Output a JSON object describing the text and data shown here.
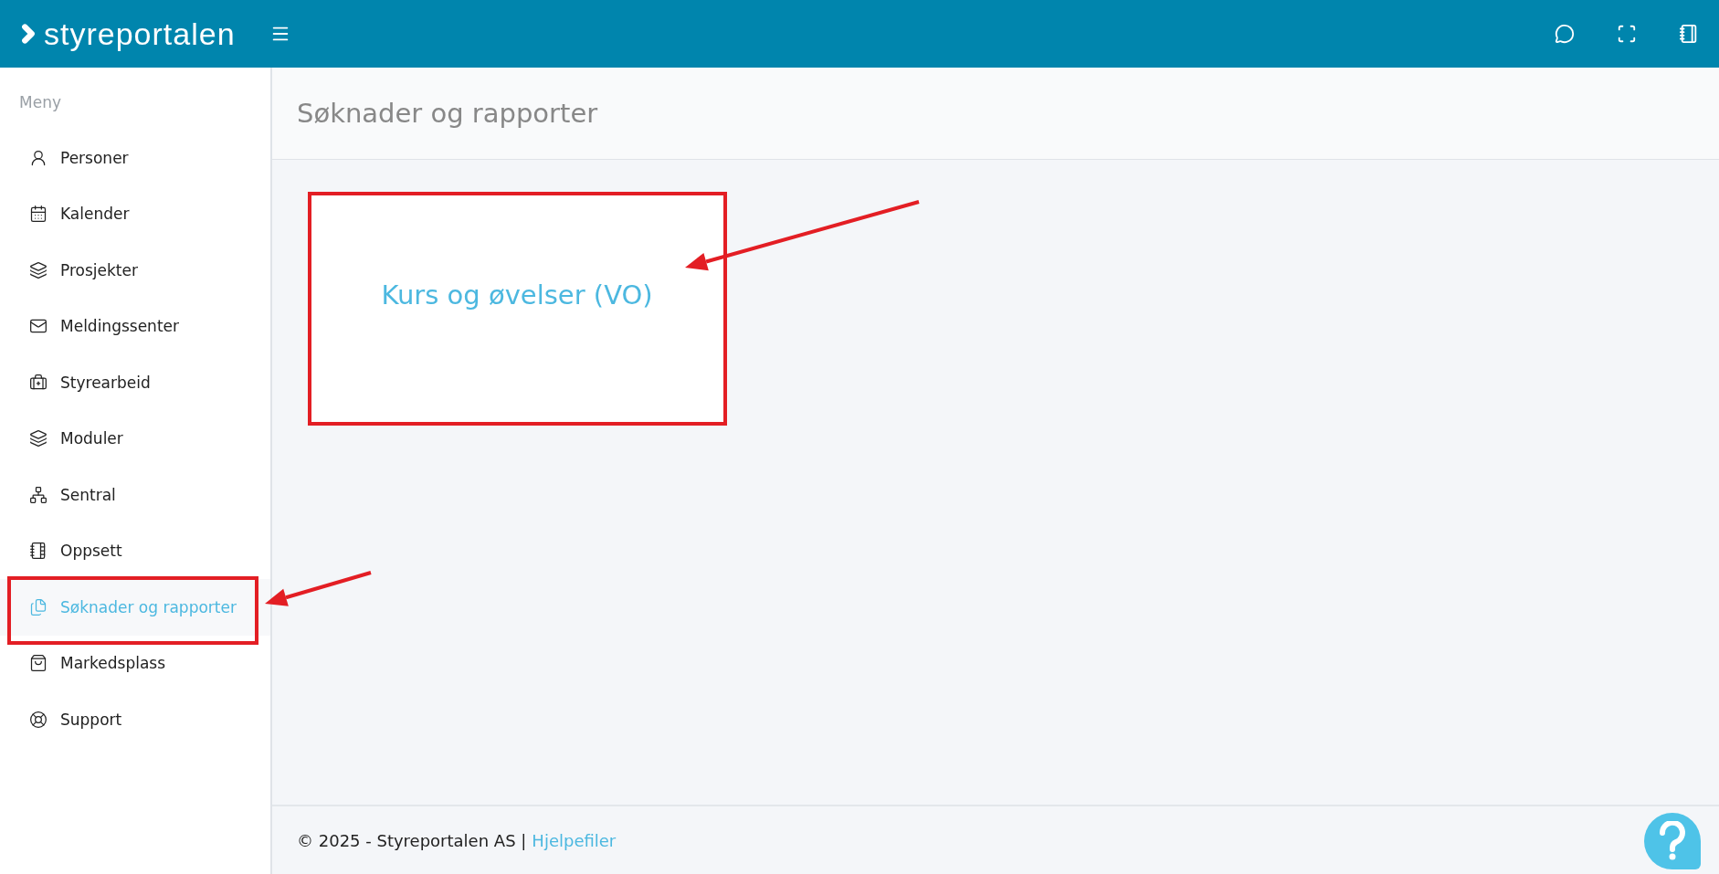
{
  "header": {
    "logo": "styreportalen"
  },
  "sidebar": {
    "heading": "Meny",
    "items": [
      {
        "label": "Personer",
        "selected": false
      },
      {
        "label": "Kalender",
        "selected": false
      },
      {
        "label": "Prosjekter",
        "selected": false
      },
      {
        "label": "Meldingssenter",
        "selected": false
      },
      {
        "label": "Styrearbeid",
        "selected": false
      },
      {
        "label": "Moduler",
        "selected": false
      },
      {
        "label": "Sentral",
        "selected": false
      },
      {
        "label": "Oppsett",
        "selected": false
      },
      {
        "label": "Søknader og rapporter",
        "selected": true
      },
      {
        "label": "Markedsplass",
        "selected": false
      },
      {
        "label": "Support",
        "selected": false
      }
    ]
  },
  "page": {
    "title": "Søknader og rapporter",
    "cards": [
      {
        "label": "Kurs og øvelser (VO)"
      }
    ]
  },
  "footer": {
    "copyright": "© 2025 - Styreportalen AS |",
    "link": "Hjelpefiler"
  }
}
